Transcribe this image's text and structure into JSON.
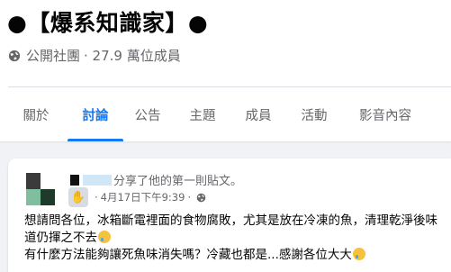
{
  "group": {
    "title": "●【爆系知識家】●",
    "privacy": "公開社團",
    "member_count_text": "· 27.9 萬位成員"
  },
  "tabs": [
    {
      "label": "關於",
      "active": false
    },
    {
      "label": "討論",
      "active": true
    },
    {
      "label": "公告",
      "active": false
    },
    {
      "label": "主題",
      "active": false
    },
    {
      "label": "成員",
      "active": false
    },
    {
      "label": "活動",
      "active": false
    },
    {
      "label": "影音內容",
      "active": false
    }
  ],
  "post": {
    "author_action": "分享了他的第一則貼文。",
    "timestamp": "4月17日下午9:39",
    "separator_dot": "·",
    "body_line_1": "想請問各位，冰箱斷電裡面的食物腐敗，尤其是放在冷凍的魚，清理乾淨後味道仍揮之不去",
    "body_line_2": "有什麼方法能夠讓死魚味消失嗎？冷藏也都是...感謝各位大大"
  },
  "colors": {
    "accent": "#1877f2",
    "muted_text": "#65676b",
    "background": "#f0f2f5"
  },
  "icons": {
    "privacy": "globe-icon",
    "post_audience": "globe-icon",
    "new_member_badge": "waving-hand-icon"
  }
}
